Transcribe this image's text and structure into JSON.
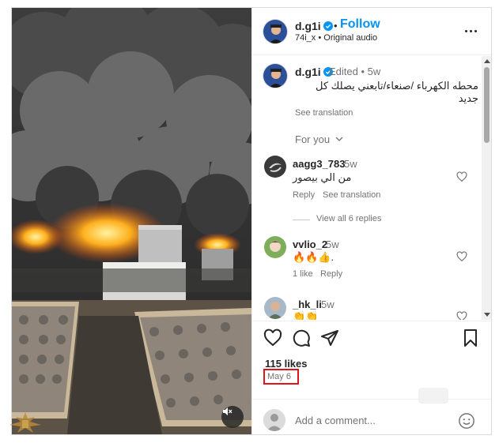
{
  "post": {
    "username": "d.g1i",
    "follow_label": "Follow",
    "audio_label": "74i_x • Original audio",
    "more_icon": "more-horizontal-icon"
  },
  "caption": {
    "username": "d.g1i",
    "meta": "Edited • 5w",
    "text": "محطه الكهرباء /صنعاء/تابعني يصلك كل جديد",
    "see_translation": "See translation",
    "for_you": "For you"
  },
  "comments": [
    {
      "username": "aagg3_783",
      "time": "5w",
      "text": "من الي بيصور",
      "actions": [
        "Reply",
        "See translation"
      ]
    },
    {
      "username": "vvlio_2",
      "time": "5w",
      "text": "🔥🔥👍.",
      "actions": [
        "1 like",
        "Reply"
      ]
    },
    {
      "username": "_hk_li",
      "time": "5w",
      "text": "👏👏",
      "actions": []
    }
  ],
  "view_replies": "View all 6 replies",
  "engagement": {
    "likes": "115 likes",
    "date": "May 6"
  },
  "add_comment": {
    "placeholder": "Add a comment..."
  },
  "colors": {
    "accent": "#0095f6",
    "text": "#262626",
    "secondary": "#737373",
    "highlight_box": "#e2141b"
  },
  "icons": [
    "verified-badge-icon",
    "heart-icon",
    "comment-icon",
    "share-icon",
    "bookmark-icon",
    "emoji-icon",
    "mute-icon",
    "chevron-down-icon"
  ]
}
